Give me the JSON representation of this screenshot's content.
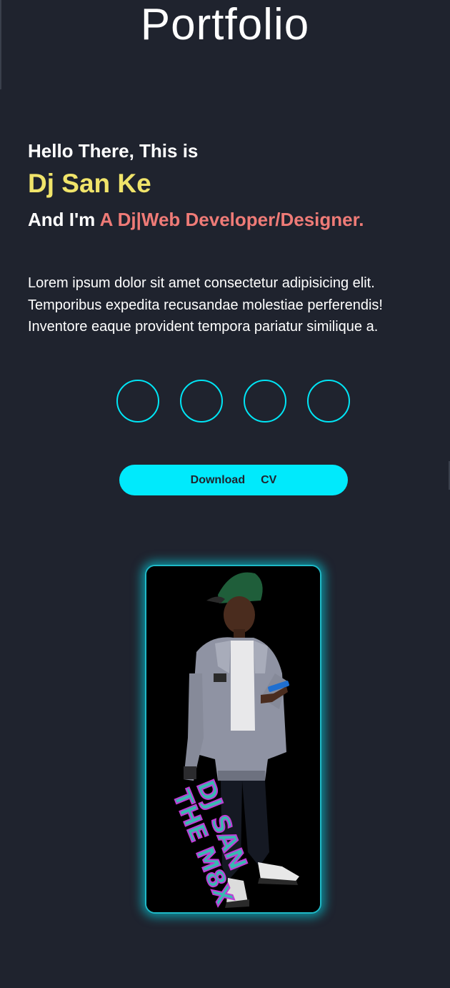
{
  "header": {
    "title": "Portfolio"
  },
  "intro": {
    "greeting": "Hello There, This is",
    "name": "Dj San Ke",
    "role_prefix": "And I'm",
    "role": "A Dj|Web Developer/Designer.",
    "description_lines": [
      "Lorem ipsum dolor sit amet consectetur adipisicing elit.",
      "Temporibus expedita recusandae molestiae perferendis!",
      "Inventore eaque provident tempora pariatur similique a."
    ]
  },
  "social": {
    "icons": [
      "social-link-1",
      "social-link-2",
      "social-link-3",
      "social-link-4"
    ]
  },
  "cv_button": {
    "word1": "Download",
    "word2": "CV"
  },
  "profile": {
    "photo_icon": "dj-person-photo",
    "logo_line1": "DJ SAN",
    "logo_line2": "THE M8X"
  },
  "colors": {
    "background": "#1f232e",
    "accent_cyan": "#00eafc",
    "name_yellow": "#f0e46a",
    "role_coral": "#ef7b77"
  }
}
